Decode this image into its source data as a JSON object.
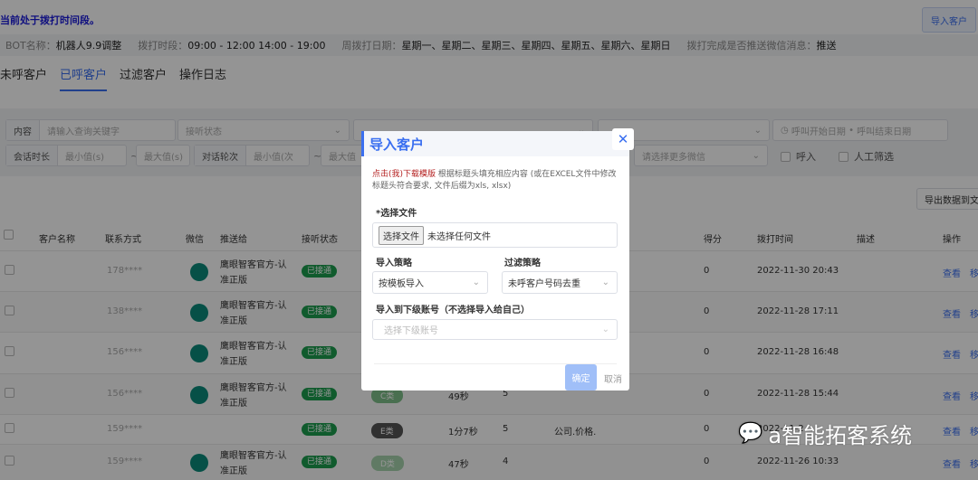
{
  "header": {
    "notice": "当前处于拨打时间段。",
    "import_button": "导入客户"
  },
  "info": [
    {
      "k": "BOT名称：",
      "v": "机器人9.9调整"
    },
    {
      "k": "拨打时段：",
      "v": "09:00 - 12:00 14:00 - 19:00"
    },
    {
      "k": "周拨打日期：",
      "v": "星期一、星期二、星期三、星期四、星期五、星期六、星期日"
    },
    {
      "k": "拨打完成是否推送微信消息：",
      "v": "推送"
    }
  ],
  "tabs": [
    "未呼客户",
    "已呼客户",
    "过滤客户",
    "操作日志"
  ],
  "filters": {
    "content_label": "内容",
    "content_placeholder": "请输入查询关键字",
    "answer_status": "接听状态",
    "date_start": "呼叫开始日期",
    "date_end": "呼叫结束日期",
    "duration_label": "会话时长",
    "min_s": "最小值(s)",
    "max_s": "最大值(s)",
    "rounds_label": "对话轮次",
    "min_rounds": "最小值(次",
    "max_rounds": "最大值",
    "wechat_more": "请选择更多微信",
    "inbound": "呼入",
    "manual": "人工筛选",
    "tilde": "~"
  },
  "export_button": "导出数据到文",
  "table": {
    "headers": {
      "name": "客户名称",
      "phone": "联系方式",
      "wechat": "微信",
      "push": "推送给",
      "status": "接听状态",
      "score": "得分",
      "time": "拨打时间",
      "desc": "描述",
      "ops": "操作"
    },
    "rows": [
      {
        "phone": "178****",
        "push1": "鹰眼智客官方-认",
        "push2": "准正版",
        "status": "已接通",
        "level": "",
        "duration": "",
        "rounds": "",
        "kw": "",
        "score": "0",
        "time": "2022-11-30 20:43",
        "view": "查看",
        "move": "移"
      },
      {
        "phone": "138****",
        "push1": "鹰眼智客官方-认",
        "push2": "准正版",
        "status": "已接通",
        "level": "",
        "duration": "",
        "rounds": "",
        "kw": "",
        "score": "0",
        "time": "2022-11-28 17:11",
        "view": "查看",
        "move": "移"
      },
      {
        "phone": "156****",
        "push1": "鹰眼智客官方-认",
        "push2": "准正版",
        "status": "已接通",
        "level": "",
        "duration": "",
        "rounds": "",
        "kw": "",
        "score": "0",
        "time": "2022-11-28 16:48",
        "view": "查看",
        "move": "移"
      },
      {
        "phone": "156****",
        "push1": "鹰眼智客官方-认",
        "push2": "准正版",
        "status": "已接通",
        "level": "C类",
        "duration": "49秒",
        "rounds": "5",
        "kw": "",
        "score": "0",
        "time": "2022-11-28 15:44",
        "view": "查看",
        "move": "移"
      },
      {
        "phone": "159****",
        "push1": "",
        "push2": "",
        "status": "已接通",
        "level": "E类",
        "duration": "1分7秒",
        "rounds": "5",
        "kw": "公司.价格.",
        "score": "0",
        "time": "2022-11-2",
        "view": "查看",
        "move": "移"
      },
      {
        "phone": "159****",
        "push1": "鹰眼智客官方-认",
        "push2": "准正版",
        "status": "已接通",
        "level": "D类",
        "duration": "47秒",
        "rounds": "4",
        "kw": "",
        "score": "0",
        "time": "2022-11-26 10:33",
        "view": "查看",
        "move": "移"
      }
    ]
  },
  "modal": {
    "title": "导入客户",
    "close": "✕",
    "download_link": "点击(我)下载模版",
    "hint": " 根据标题头填充相应内容 (或在EXCEL文件中修改标题头符合要求, 文件后缀为xls, xlsx)",
    "file_label": "*选择文件",
    "file_button": "选择文件",
    "file_status": "未选择任何文件",
    "import_strategy_label": "导入策略",
    "import_strategy": "按模板导入",
    "filter_strategy_label": "过滤策略",
    "filter_strategy": "未呼客户号码去重",
    "sub_account_label": "导入到下级账号（不选择导入给自己）",
    "sub_account_placeholder": "选择下级账号",
    "confirm": "确定",
    "cancel": "取消"
  },
  "watermark": "a智能拓客系统",
  "colors": {
    "accent": "#3a6ff0",
    "success": "#1c9e4f"
  }
}
